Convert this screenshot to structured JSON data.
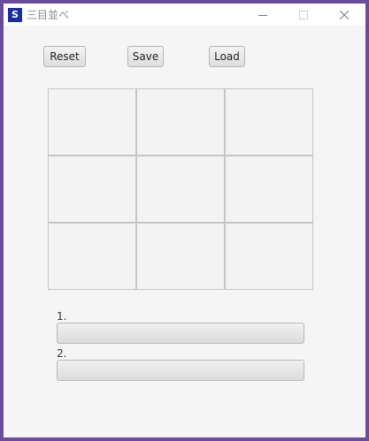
{
  "window": {
    "title": "三目並べ",
    "icon_letter": "S",
    "icon_color": "#1a2f9a",
    "frame_color": "#6a4c9c",
    "controls": [
      "minimize-icon",
      "maximize-icon",
      "close-icon"
    ]
  },
  "toolbar": {
    "reset_label": "Reset",
    "save_label": "Save",
    "load_label": "Load"
  },
  "board": {
    "rows": 3,
    "cols": 3,
    "cells": [
      "",
      "",
      "",
      "",
      "",
      "",
      "",
      "",
      ""
    ]
  },
  "moves": [
    {
      "label": "1.",
      "value": ""
    },
    {
      "label": "2.",
      "value": ""
    }
  ]
}
